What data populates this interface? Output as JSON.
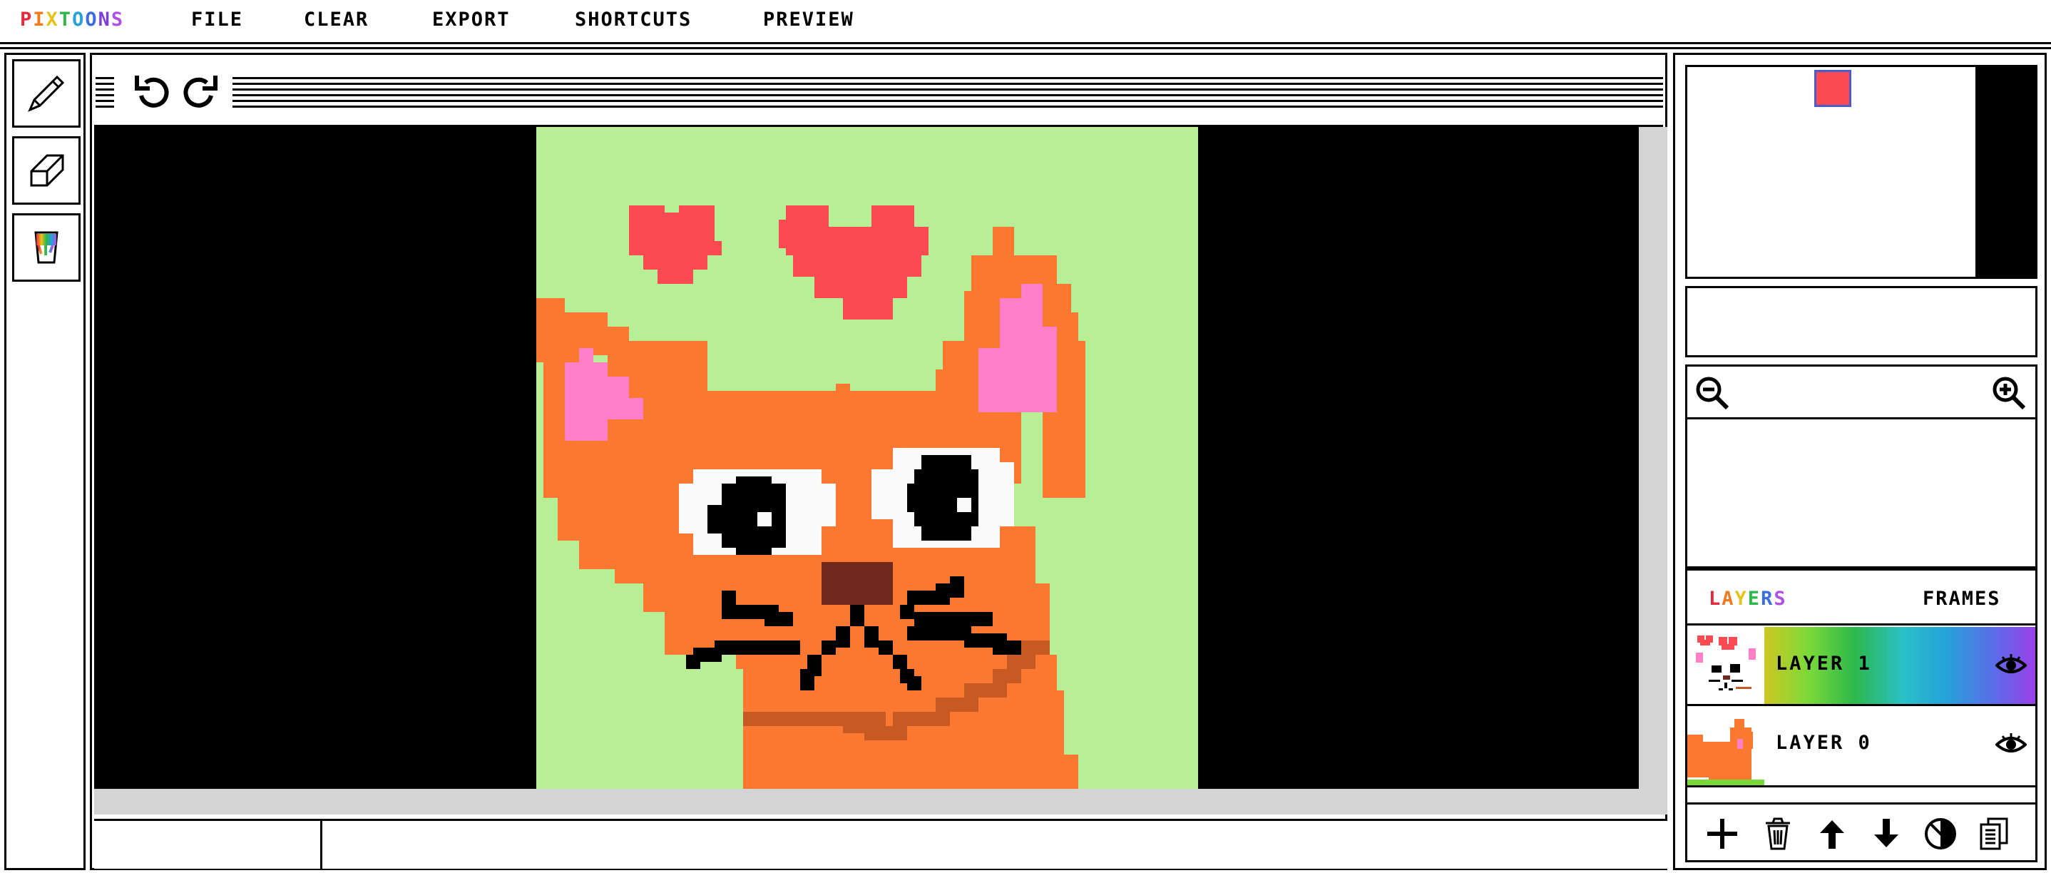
{
  "menu": {
    "logo_letters": [
      "P",
      "I",
      "X",
      "T",
      "O",
      "O",
      "N",
      "S"
    ],
    "logo_colors": [
      "#e8283c",
      "#f07a1e",
      "#e8c21a",
      "#2db84a",
      "#25a3d9",
      "#3a6de0",
      "#7a3fe0",
      "#b04fe8"
    ],
    "file": "FILE",
    "clear": "CLEAR",
    "export": "EXPORT",
    "shortcuts": "SHORTCUTS",
    "preview": "PREVIEW"
  },
  "tools": [
    "pencil-icon",
    "eraser-icon",
    "paint-bucket-icon"
  ],
  "toolbar": {
    "undo_icon": "undo-icon",
    "redo_icon": "redo-icon"
  },
  "colors": {
    "primary": "#fc4a52",
    "background_canvas": "#000000",
    "art_bg": "#b8ef96",
    "cat_orange": "#fa782f",
    "ear_pink": "#ff7fc8",
    "heart_red": "#fc4a52",
    "nose_brown": "#71281d",
    "mouth_brown": "#c75a23"
  },
  "zoom": {
    "out_icon": "zoom-out-icon",
    "in_icon": "zoom-in-icon"
  },
  "layers_panel": {
    "tab_layers_letters": [
      "L",
      "A",
      "Y",
      "E",
      "R",
      "S"
    ],
    "tab_layers_colors": [
      "#e8283c",
      "#f07a1e",
      "#e8c21a",
      "#2db84a",
      "#3a6de0",
      "#b04fe8"
    ],
    "tab_frames": "FRAMES",
    "layers": [
      {
        "label": "LAYER 1",
        "visible_icon": "eye-icon",
        "selected": true
      },
      {
        "label": "LAYER 0",
        "visible_icon": "eye-icon",
        "selected": false
      }
    ]
  },
  "layer_actions": [
    "add-layer-icon",
    "delete-layer-icon",
    "move-up-icon",
    "move-down-icon",
    "merge-icon",
    "duplicate-icon"
  ]
}
